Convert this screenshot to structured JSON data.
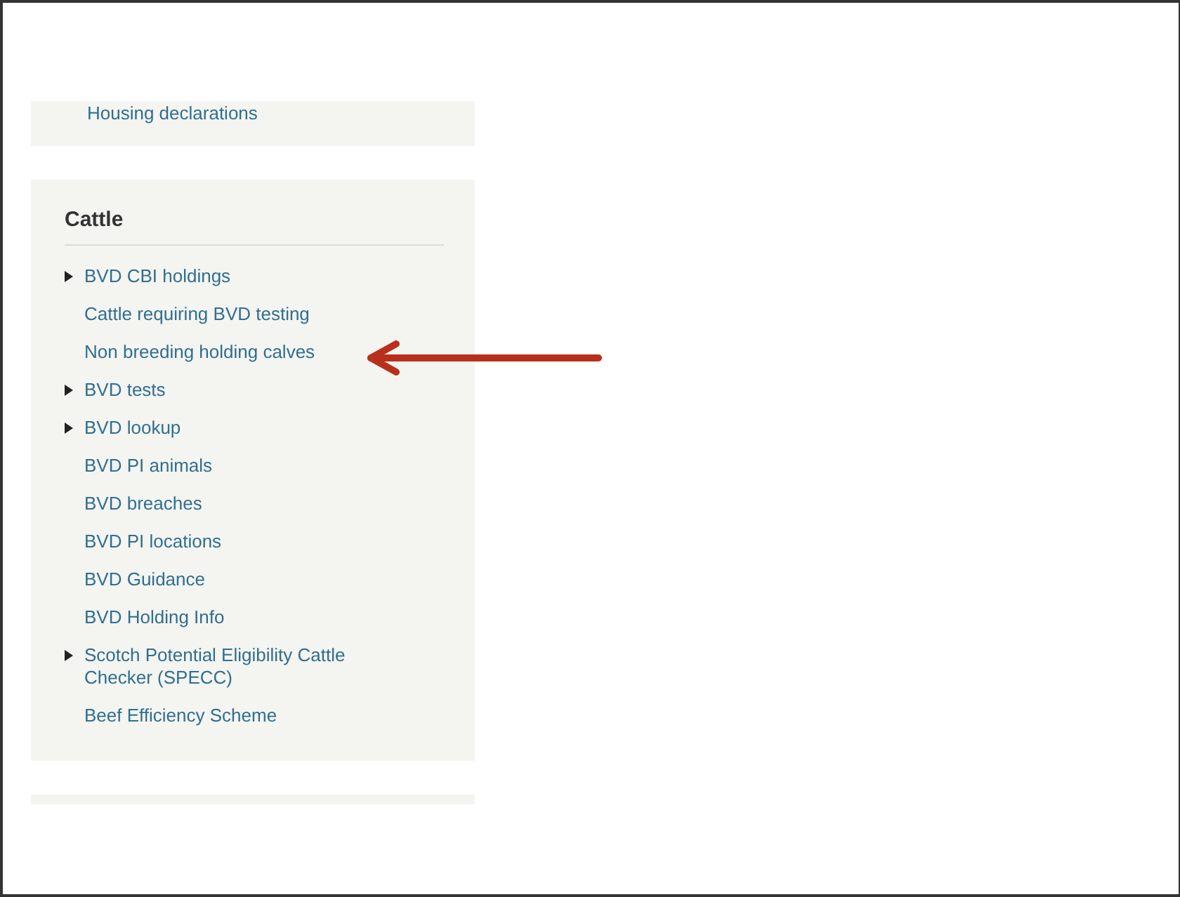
{
  "previous_panel": {
    "last_item": "Housing declarations"
  },
  "cattle_panel": {
    "title": "Cattle",
    "items": [
      {
        "label": "BVD CBI holdings",
        "kind": "expandable"
      },
      {
        "label": "Cattle requiring BVD testing",
        "kind": "link"
      },
      {
        "label": "Non breeding holding calves",
        "kind": "link"
      },
      {
        "label": "BVD tests",
        "kind": "expandable"
      },
      {
        "label": "BVD lookup",
        "kind": "expandable"
      },
      {
        "label": "BVD PI animals",
        "kind": "link"
      },
      {
        "label": "BVD breaches",
        "kind": "link"
      },
      {
        "label": "BVD PI locations",
        "kind": "link"
      },
      {
        "label": "BVD Guidance",
        "kind": "link"
      },
      {
        "label": "BVD Holding Info",
        "kind": "link"
      },
      {
        "label": "Scotch Potential Eligibility Cattle Checker (SPECC)",
        "kind": "expandable"
      },
      {
        "label": "Beef Efficiency Scheme",
        "kind": "link"
      }
    ]
  }
}
